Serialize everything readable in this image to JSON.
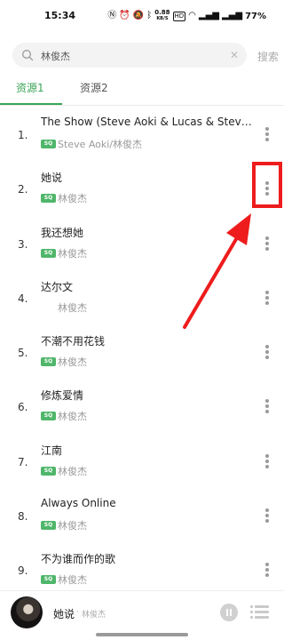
{
  "status_bar": {
    "time": "15:34",
    "network_speed": "0.88",
    "network_speed_unit": "KB/S",
    "battery": "77%"
  },
  "search": {
    "query": "林俊杰",
    "button_label": "搜索"
  },
  "tabs": [
    {
      "label": "资源1",
      "active": true
    },
    {
      "label": "资源2",
      "active": false
    }
  ],
  "songs": [
    {
      "index": "1.",
      "title": "The Show (Steve Aoki & Lucas & Steve Re...",
      "artist": "Steve Aoki/林俊杰",
      "badge": "SQ"
    },
    {
      "index": "2.",
      "title": "她说",
      "artist": "林俊杰",
      "badge": "SQ"
    },
    {
      "index": "3.",
      "title": "我还想她",
      "artist": "林俊杰",
      "badge": "SQ"
    },
    {
      "index": "4.",
      "title": "达尔文",
      "artist": "林俊杰",
      "badge": ""
    },
    {
      "index": "5.",
      "title": "不潮不用花钱",
      "artist": "林俊杰",
      "badge": "SQ"
    },
    {
      "index": "6.",
      "title": "修炼爱情",
      "artist": "林俊杰",
      "badge": "SQ"
    },
    {
      "index": "7.",
      "title": "江南",
      "artist": "林俊杰",
      "badge": "SQ"
    },
    {
      "index": "8.",
      "title": "Always Online",
      "artist": "林俊杰",
      "badge": "SQ"
    },
    {
      "index": "9.",
      "title": "不为谁而作的歌",
      "artist": "林俊杰",
      "badge": "SQ"
    }
  ],
  "now_playing": {
    "title": "她说",
    "separator": "·",
    "artist": "林俊杰"
  },
  "colors": {
    "accent": "#3aa556",
    "badge": "#4fb66a",
    "annotation": "#ee1c1c"
  }
}
